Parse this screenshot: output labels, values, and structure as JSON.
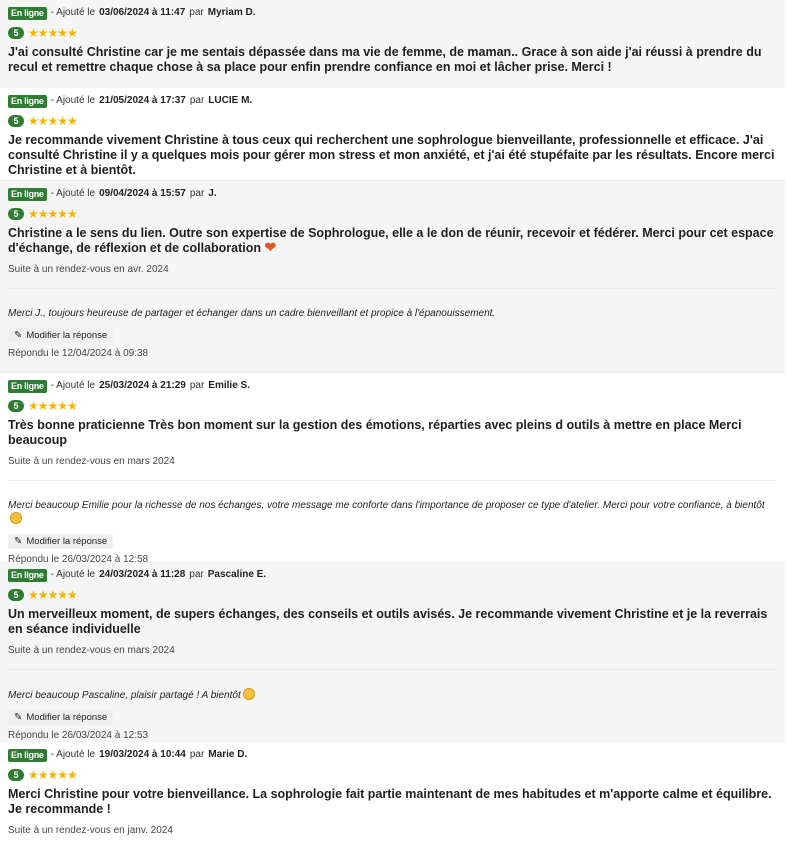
{
  "labels": {
    "online": "En ligne",
    "added": "- Ajouté le",
    "by": "par",
    "edit_reply": "Modifier la réponse"
  },
  "reviews": [
    {
      "date": "03/06/2024 à 11:47",
      "author": "Myriam D.",
      "score": "5",
      "stars": "★★★★★",
      "text": "J'ai consulté Christine car je me sentais dépassée dans ma vie de femme, de maman.. Grace à son aide j'ai réussi à prendre du recul et remettre chaque chose à sa place pour enfin prendre confiance en moi et lâcher prise. Merci !"
    },
    {
      "date": "21/05/2024 à 17:37",
      "author": "LUCIE M.",
      "score": "5",
      "stars": "★★★★★",
      "text": "Je recommande vivement Christine à tous ceux qui recherchent une sophrologue bienveillante, professionnelle et efficace. J'ai consulté Christine il y a quelques mois pour gérer mon stress et mon anxiété, et j'ai été stupéfaite par les résultats. Encore merci Christine et à bientôt."
    },
    {
      "date": "09/04/2024 à 15:57",
      "author": "J.",
      "score": "5",
      "stars": "★★★★★",
      "text": "Christine a le sens du lien. Outre son expertise de Sophrologue, elle a le don de réunir, recevoir et fédérer. Merci pour cet espace d'échange, de réflexion et de collaboration",
      "heart": "❤",
      "context": "Suite à un rendez-vous en avr. 2024",
      "reply": "Merci J., toujours heureuse de partager et échanger dans un cadre bienveillant et propice à l'épanouissement.",
      "replied": "Répondu le 12/04/2024 à 09:38"
    },
    {
      "date": "25/03/2024 à 21:29",
      "author": "Emilie S.",
      "score": "5",
      "stars": "★★★★★",
      "text": "Très bonne praticienne Très bon moment sur la gestion des émotions, réparties avec pleins d outils à mettre en place Merci beaucoup",
      "context": "Suite à un rendez-vous en mars 2024",
      "reply": "Merci beaucoup Emilie pour la richesse de nos échanges, votre message me conforte dans l'importance de proposer ce type d'atelier. Merci pour votre confiance, à bientôt",
      "replied": "Répondu le 26/03/2024 à 12:58"
    },
    {
      "date": "24/03/2024 à 11:28",
      "author": "Pascaline E.",
      "score": "5",
      "stars": "★★★★★",
      "text": "Un merveilleux moment, de supers échanges, des conseils et outils avisés. Je recommande vivement Christine et je la reverrais en séance individuelle",
      "context": "Suite à un rendez-vous en mars 2024",
      "reply": "Merci beaucoup Pascaline, plaisir partagé ! A bientôt",
      "replied": "Répondu le 26/03/2024 à 12:53"
    },
    {
      "date": "19/03/2024 à 10:44",
      "author": "Marie D.",
      "score": "5",
      "stars": "★★★★★",
      "text": "Merci Christine pour votre bienveillance. La sophrologie fait partie maintenant de mes habitudes et m'apporte calme et équilibre. Je recommande !",
      "context": "Suite à un rendez-vous en janv. 2024"
    }
  ]
}
